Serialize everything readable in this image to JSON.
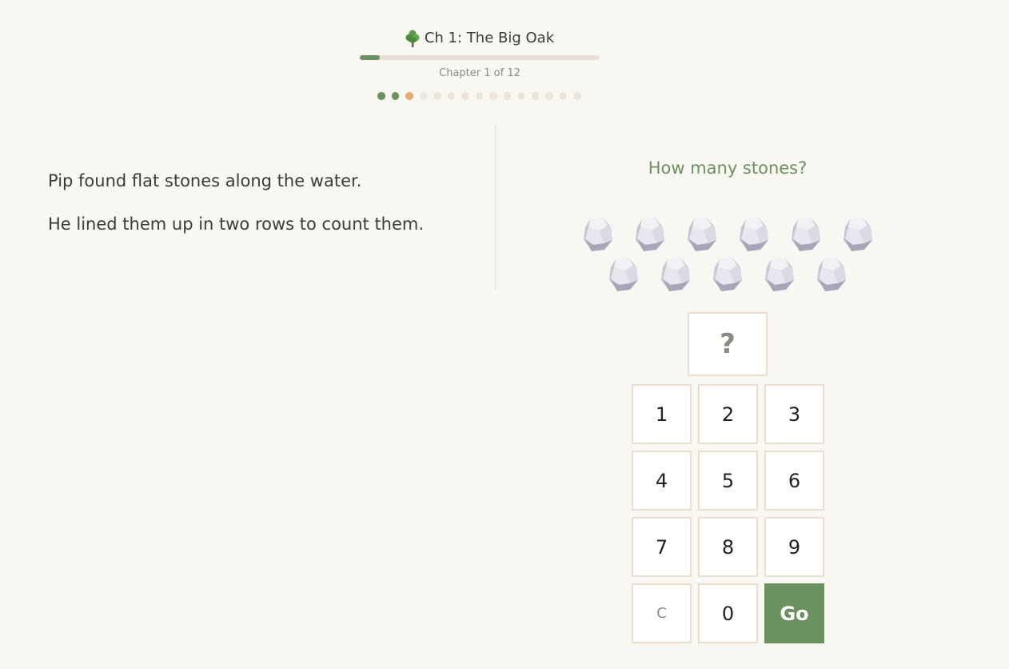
{
  "header": {
    "chapter_title": "Ch 1: The Big Oak",
    "chapter_count": "Chapter 1 of 12",
    "progress_fraction": 0.083,
    "tree_icon": "tree-icon"
  },
  "level_dots": {
    "total": 15,
    "completed": 2,
    "current_index": 2
  },
  "story": {
    "lines": [
      "Pip found flat stones along the water.",
      "He lined them up in two rows to count them."
    ]
  },
  "puzzle": {
    "question": "How many stones?",
    "stone_rows": [
      6,
      5
    ],
    "stone_icon": "stone-icon",
    "answer_placeholder": "?"
  },
  "keypad": {
    "keys": [
      "1",
      "2",
      "3",
      "4",
      "5",
      "6",
      "7",
      "8",
      "9",
      "C",
      "0",
      "Go"
    ]
  },
  "colors": {
    "background": "#f9f7f2",
    "accent_green": "#6b9160",
    "current_dot": "#e8a97a",
    "track": "#e6e0d6",
    "key_border": "#eadfcf"
  }
}
